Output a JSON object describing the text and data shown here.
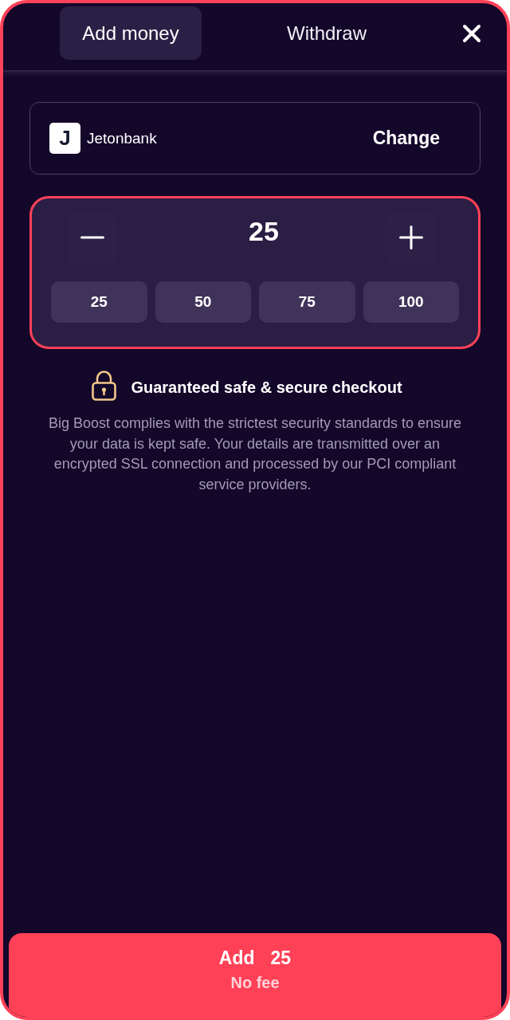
{
  "tabs": [
    {
      "label": "Add money",
      "selected": true
    },
    {
      "label": "Withdraw",
      "selected": false
    }
  ],
  "payment_method": {
    "logo_letter": "J",
    "name": "Jetonbank",
    "action": "Change"
  },
  "amount": {
    "value": "25",
    "highlighted": true,
    "presets": [
      "25",
      "50",
      "75",
      "100"
    ]
  },
  "security": {
    "title": "Guaranteed safe & secure checkout",
    "text": "Big Boost complies with the strictest security standards to ensure your data is kept safe. Your details are transmitted over an encrypted SSL connection and processed by our PCI compliant service providers."
  },
  "submit": {
    "label": "Add",
    "amount": "25",
    "note": "No fee"
  }
}
